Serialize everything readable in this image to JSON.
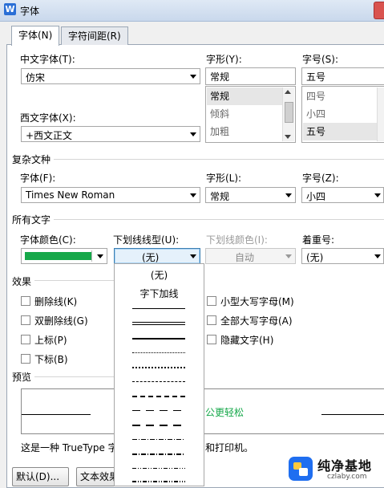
{
  "window": {
    "title": "字体",
    "app_icon_glyph": "W"
  },
  "tabs": [
    {
      "label": "字体(N)"
    },
    {
      "label": "字符间距(R)"
    }
  ],
  "latin": {
    "chinese_font_label": "中文字体(T):",
    "chinese_font_value": "仿宋",
    "western_font_label": "西文字体(X):",
    "western_font_value": "+西文正文",
    "style_label": "字形(Y):",
    "style_value": "常规",
    "style_options": [
      "常规",
      "倾斜",
      "加粗"
    ],
    "size_label": "字号(S):",
    "size_value": "五号",
    "size_options": [
      "四号",
      "小四",
      "五号"
    ]
  },
  "complex": {
    "section_title": "复杂文种",
    "font_label": "字体(F):",
    "font_value": "Times New Roman",
    "style_label": "字形(L):",
    "style_value": "常规",
    "size_label": "字号(Z):",
    "size_value": "小四"
  },
  "all_text": {
    "section_title": "所有文字",
    "font_color_label": "字体颜色(C):",
    "font_color": "#16a84a",
    "underline_type_label": "下划线线型(U):",
    "underline_type_value": "(无)",
    "underline_color_label": "下划线颜色(I):",
    "underline_color_value": "自动",
    "emphasis_label": "着重号:",
    "emphasis_value": "(无)"
  },
  "underline_dropdown": {
    "items": [
      "(无)",
      "字下加线"
    ]
  },
  "effects": {
    "section_title": "效果",
    "left": [
      "删除线(K)",
      "双删除线(G)",
      "上标(P)",
      "下标(B)"
    ],
    "right": [
      "小型大写字母(M)",
      "全部大写字母(A)",
      "隐藏文字(H)"
    ]
  },
  "preview": {
    "section_title": "预览",
    "sample_text": "公更轻松",
    "sample_color": "#16a84a",
    "note_left": "这是一种 TrueType 字",
    "note_right": "和打印机。"
  },
  "buttons": {
    "default": "默认(D)...",
    "text_effects": "文本效果"
  },
  "watermark": {
    "text": "纯净基地",
    "url": "czlaby.com"
  }
}
